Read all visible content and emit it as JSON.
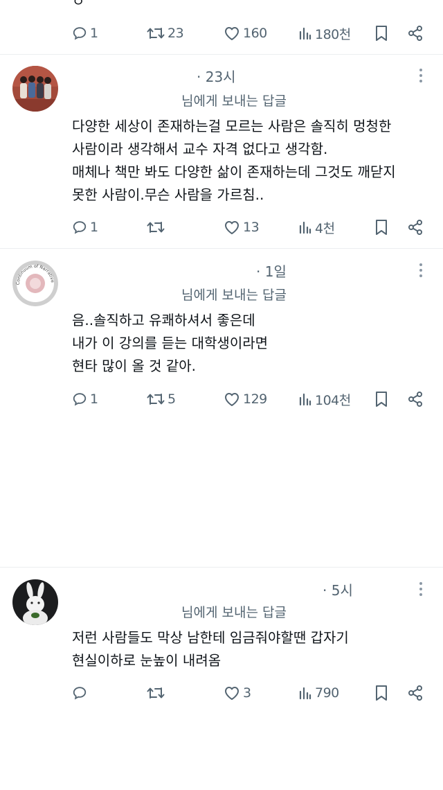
{
  "top": {
    "fragment_text": "ㅇ",
    "reply_count": "1",
    "retweet_count": "23",
    "like_count": "160",
    "view_count": "180천"
  },
  "tweets": [
    {
      "time": "· 23시",
      "reply_to": "님에게 보내는 답글",
      "lines": [
        "다양한 세상이 존재하는걸 모르는 사람은 솔직히 멍청한",
        "사람이라 생각해서 교수 자격 없다고 생각함.",
        "매체나 책만 봐도 다양한 삶이 존재하는데 그것도 깨닫지",
        "못한 사람이.무슨 사람을 가르침.."
      ],
      "reply_count": "1",
      "retweet_count": "",
      "like_count": "13",
      "view_count": "4천"
    },
    {
      "time": "· 1일",
      "reply_to": "님에게 보내는 답글",
      "avatar_text": "Continuum of Narratives",
      "lines": [
        "음..솔직하고 유쾌하셔서 좋은데",
        "내가 이 강의를 듣는 대학생이라면",
        "현타 많이 올 것 같아."
      ],
      "reply_count": "1",
      "retweet_count": "5",
      "like_count": "129",
      "view_count": "104천"
    },
    {
      "time": "· 5시",
      "reply_to": "님에게 보내는 답글",
      "lines": [
        "저런 사람들도 막상 남한테 임금줘야할땐 갑자기",
        "현실이하로 눈높이 내려옴"
      ],
      "reply_count": "",
      "retweet_count": "",
      "like_count": "3",
      "view_count": "790"
    }
  ],
  "icons": {
    "reply": "reply-icon",
    "retweet": "retweet-icon",
    "like": "heart-icon",
    "views": "views-icon",
    "bookmark": "bookmark-icon",
    "share": "share-icon",
    "more": "more-vertical-icon"
  },
  "colors": {
    "text": "#0f1419",
    "muted": "#536471",
    "divider": "#eceef0"
  }
}
